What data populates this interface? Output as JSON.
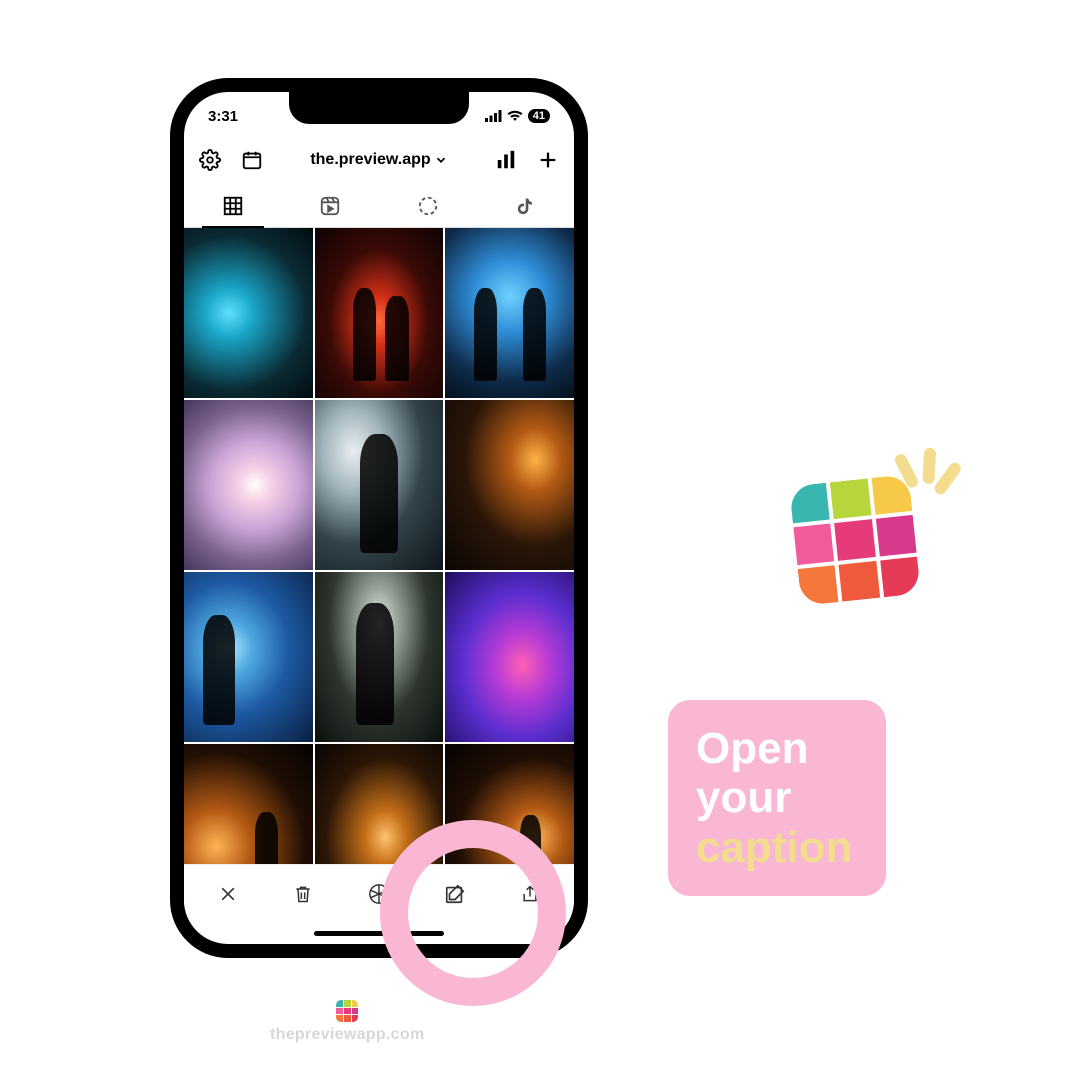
{
  "status": {
    "time": "3:31",
    "battery": "41"
  },
  "toolbar": {
    "account": "the.preview.app"
  },
  "logo": {
    "colors": [
      "#3ab6b0",
      "#b6d63c",
      "#f7c948",
      "#f15a9b",
      "#e63b7a",
      "#d83a8b",
      "#f4783c",
      "#ef5a3c",
      "#e63b57"
    ]
  },
  "callout": {
    "line1": "Open",
    "line2": "your",
    "line3": "caption"
  },
  "watermark": {
    "text": "thepreviewapp.com"
  }
}
